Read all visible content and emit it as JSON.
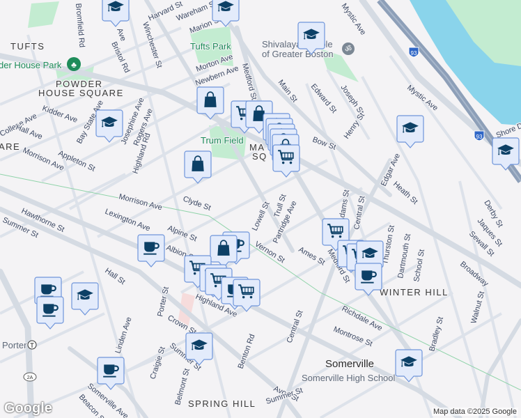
{
  "map": {
    "attribution": "Map data ©2025 Google",
    "logo": "Google",
    "colors": {
      "water": "#8ad4eb",
      "park": "#c3ecd1",
      "road": "#d5dbe3",
      "highway": "#8d9fb8",
      "marker_fill": "#e3ebfb",
      "marker_border": "#6f95da",
      "icon": "#0c4066"
    },
    "neighborhoods": [
      "TUFTS",
      "POWDER",
      "HOUSE SQUARE",
      "ARE",
      "WINTER HILL",
      "SPRING HILL",
      "MA",
      "SQ"
    ],
    "city": "Somerville",
    "parks": [
      "Tufts Park",
      "Trum Field",
      "der House Park"
    ],
    "pois": [
      "Shivalaya Temple",
      "of Greater Boston",
      "Somerville High School",
      "Porter"
    ],
    "highway_shield": "93",
    "route_shield": "2A",
    "streets": [
      "Harvard St",
      "Wareham St",
      "Marion St",
      "Bromfield Rd",
      "Bristol Rd",
      "Winchester St",
      "Morton Ave",
      "Newbern Ave",
      "Medford St",
      "Main St",
      "Edward St",
      "Joseph St",
      "Henry St",
      "Mystic Ave",
      "Bow St",
      "Edgar Ave",
      "Heath St",
      "Derby St",
      "Jaques St",
      "Sewall St",
      "Broadway",
      "Kidder Ave",
      "College Ave",
      "Hall Ave",
      "Bay State Ave",
      "Josephine Ave",
      "Rogers Ave",
      "Highland Rd",
      "Appleton St",
      "Morrison Ave",
      "Morrison Ave",
      "Clyde St",
      "Lowell St",
      "Trull St",
      "Partridge Ave",
      "Vernon St",
      "Ames St",
      "Adams St",
      "Central St",
      "Thurston St",
      "Dartmouth St",
      "School St",
      "Hawthorne St",
      "Summer St",
      "Lexington Ave",
      "Alpine St",
      "Albion St",
      "Hall St",
      "Highland Ave",
      "Porter St",
      "Crown St",
      "Linden Ave",
      "Craigie St",
      "Summer St",
      "Belmont St",
      "Benton Rd",
      "Central St",
      "Richdale Ave",
      "Montrose St",
      "Avon St",
      "Summer St",
      "Somerville Ave",
      "Beacon St",
      "Walnut St",
      "Bradley St",
      "Shore Dr",
      "Medford St",
      "Ave"
    ]
  },
  "markers": [
    {
      "type": "school"
    },
    {
      "type": "school"
    },
    {
      "type": "school"
    },
    {
      "type": "school"
    },
    {
      "type": "school"
    },
    {
      "type": "school"
    },
    {
      "type": "shopping"
    },
    {
      "type": "grocery"
    },
    {
      "type": "shopping"
    },
    {
      "type": "shopping"
    },
    {
      "type": "shopping"
    },
    {
      "type": "shopping"
    },
    {
      "type": "shopping"
    },
    {
      "type": "shopping"
    },
    {
      "type": "grocery"
    },
    {
      "type": "shopping"
    },
    {
      "type": "grocery"
    },
    {
      "type": "grocery"
    },
    {
      "type": "grocery"
    },
    {
      "type": "school"
    },
    {
      "type": "cafe"
    },
    {
      "type": "cafe"
    },
    {
      "type": "cafe"
    },
    {
      "type": "shopping"
    },
    {
      "type": "grocery"
    },
    {
      "type": "grocery"
    },
    {
      "type": "grocery"
    },
    {
      "type": "cafe"
    },
    {
      "type": "grocery"
    },
    {
      "type": "cafe"
    },
    {
      "type": "cafe"
    },
    {
      "type": "school"
    },
    {
      "type": "cafe"
    },
    {
      "type": "school"
    },
    {
      "type": "school"
    }
  ]
}
